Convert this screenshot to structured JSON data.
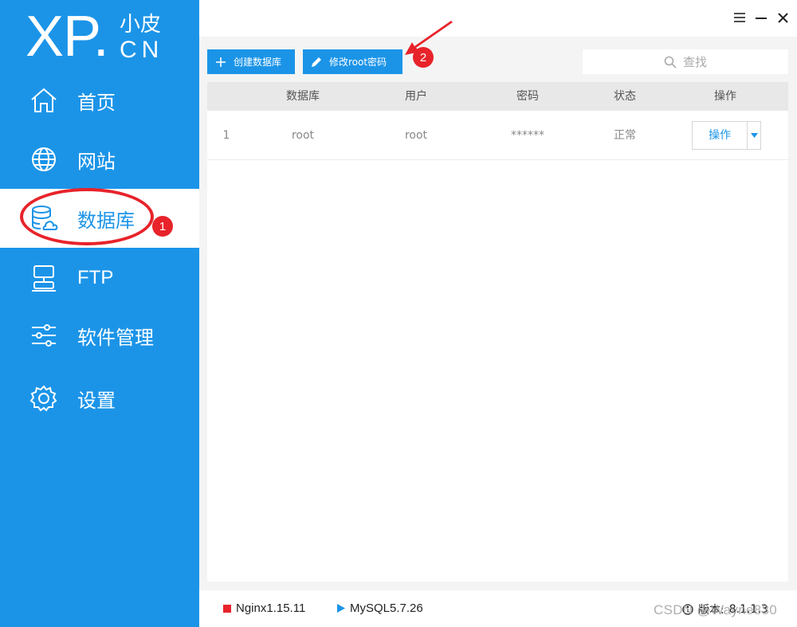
{
  "app": {
    "logo_main": "XP.",
    "logo_sub": "小皮",
    "logo_cn": "CN"
  },
  "sidebar": {
    "items": [
      {
        "label": "首页",
        "icon": "home-icon"
      },
      {
        "label": "网站",
        "icon": "globe-icon"
      },
      {
        "label": "数据库",
        "icon": "database-icon",
        "active": true
      },
      {
        "label": "FTP",
        "icon": "ftp-server-icon"
      },
      {
        "label": "软件管理",
        "icon": "sliders-icon"
      },
      {
        "label": "设置",
        "icon": "gear-icon"
      }
    ]
  },
  "toolbar": {
    "create_db_label": "创建数据库",
    "change_root_pwd_label": "修改root密码",
    "search_placeholder": "查找"
  },
  "table": {
    "columns": [
      "数据库",
      "用户",
      "密码",
      "状态",
      "操作"
    ],
    "rows": [
      {
        "index": "1",
        "database": "root",
        "user": "root",
        "password": "******",
        "status": "正常",
        "action": "操作"
      }
    ]
  },
  "statusbar": {
    "nginx": "Nginx1.15.11",
    "mysql": "MySQL5.7.26",
    "version_label": "版本:",
    "version": "8.1.1.3"
  },
  "annotations": {
    "badge1": "1",
    "badge2": "2"
  },
  "watermark": "CSDN @Wayne830",
  "colors": {
    "brand": "#1b94e8",
    "nginx_stopped": "#e8232a",
    "mysql_running": "#1b94e8",
    "annotation": "#e8232a"
  }
}
